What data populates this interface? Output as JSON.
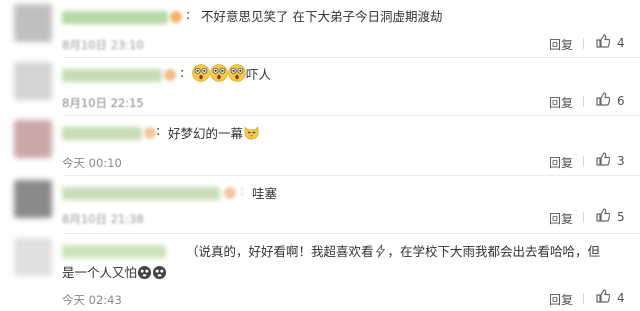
{
  "comments": [
    {
      "text": "不好意思见笑了 在下大弟子今日洞虚期渡劫",
      "time": "8月10日 23:10",
      "reply": "回复",
      "likes": "4"
    },
    {
      "text": "吓人",
      "emoji_names": [
        "shocked-face-icon",
        "shocked-face-icon",
        "shocked-face-icon"
      ],
      "time": "8月10日 22:15",
      "reply": "回复",
      "likes": "6"
    },
    {
      "text": "好梦幻的一幕",
      "emoji_names": [
        "cat-face-icon"
      ],
      "time": "今天 00:10",
      "reply": "回复",
      "likes": "3"
    },
    {
      "text": "哇塞",
      "time": "8月10日 21:38",
      "reply": "回复",
      "likes": "5"
    },
    {
      "text_line1": "（说真的，好好看啊！我超喜欢看",
      "text_line1b": "，在学校下大雨我都会出去看哈哈，但",
      "text_line2": "是一个人又怕",
      "emoji_names": [
        "lightning-icon",
        "scared-face-icon",
        "scared-face-icon"
      ],
      "time": "今天 02:43",
      "reply": "回复",
      "likes": "4"
    }
  ],
  "colors": {
    "like_icon": "#666666",
    "divider": "#ececec",
    "time_text": "#888888"
  }
}
